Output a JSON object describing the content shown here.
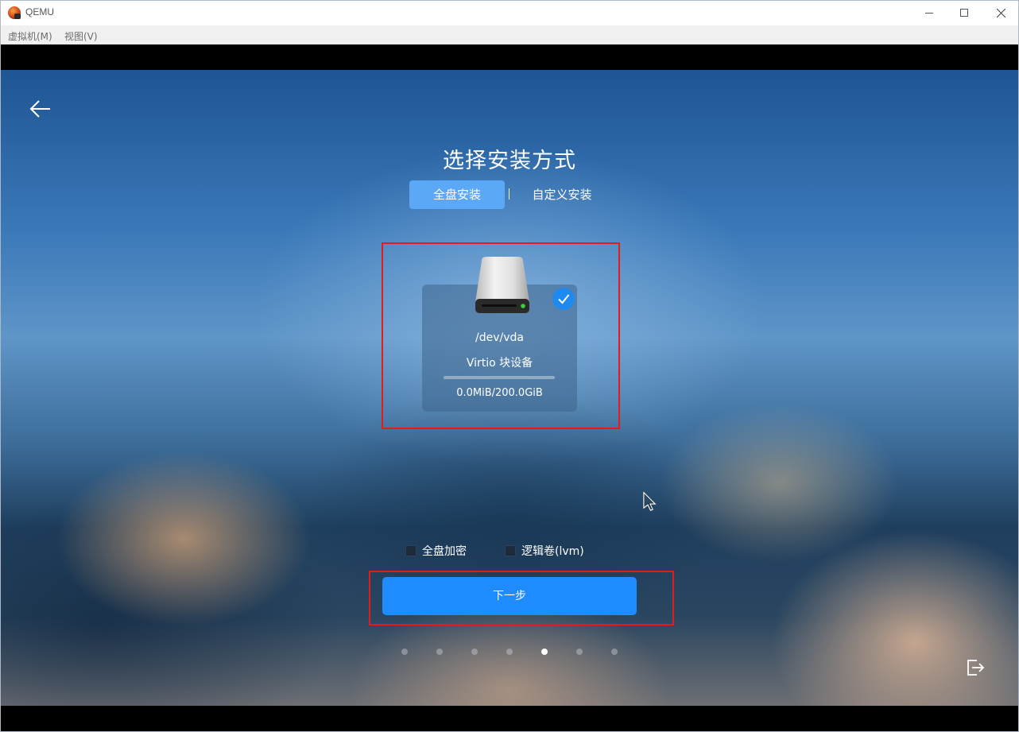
{
  "window": {
    "title": "QEMU"
  },
  "menubar": {
    "items": [
      {
        "label": "虚拟机(M)"
      },
      {
        "label": "视图(V)"
      }
    ]
  },
  "installer": {
    "title": "选择安装方式",
    "tabs": [
      {
        "label": "全盘安装",
        "selected": true
      },
      {
        "label": "自定义安装",
        "selected": false
      }
    ],
    "disk": {
      "device": "/dev/vda",
      "model": "Virtio 块设备",
      "usage": "0.0MiB/200.0GiB",
      "used_fraction": 0,
      "selected": true
    },
    "options": [
      {
        "label": "全盘加密",
        "checked": false
      },
      {
        "label": "逻辑卷(lvm)",
        "checked": false
      }
    ],
    "next_button": "下一步",
    "pager": {
      "total_steps": 7,
      "current_step": 5
    }
  },
  "colors": {
    "accent": "#1e8bff",
    "tab_selected": "#5aa8f6",
    "highlight_outline": "#e31b1b"
  }
}
